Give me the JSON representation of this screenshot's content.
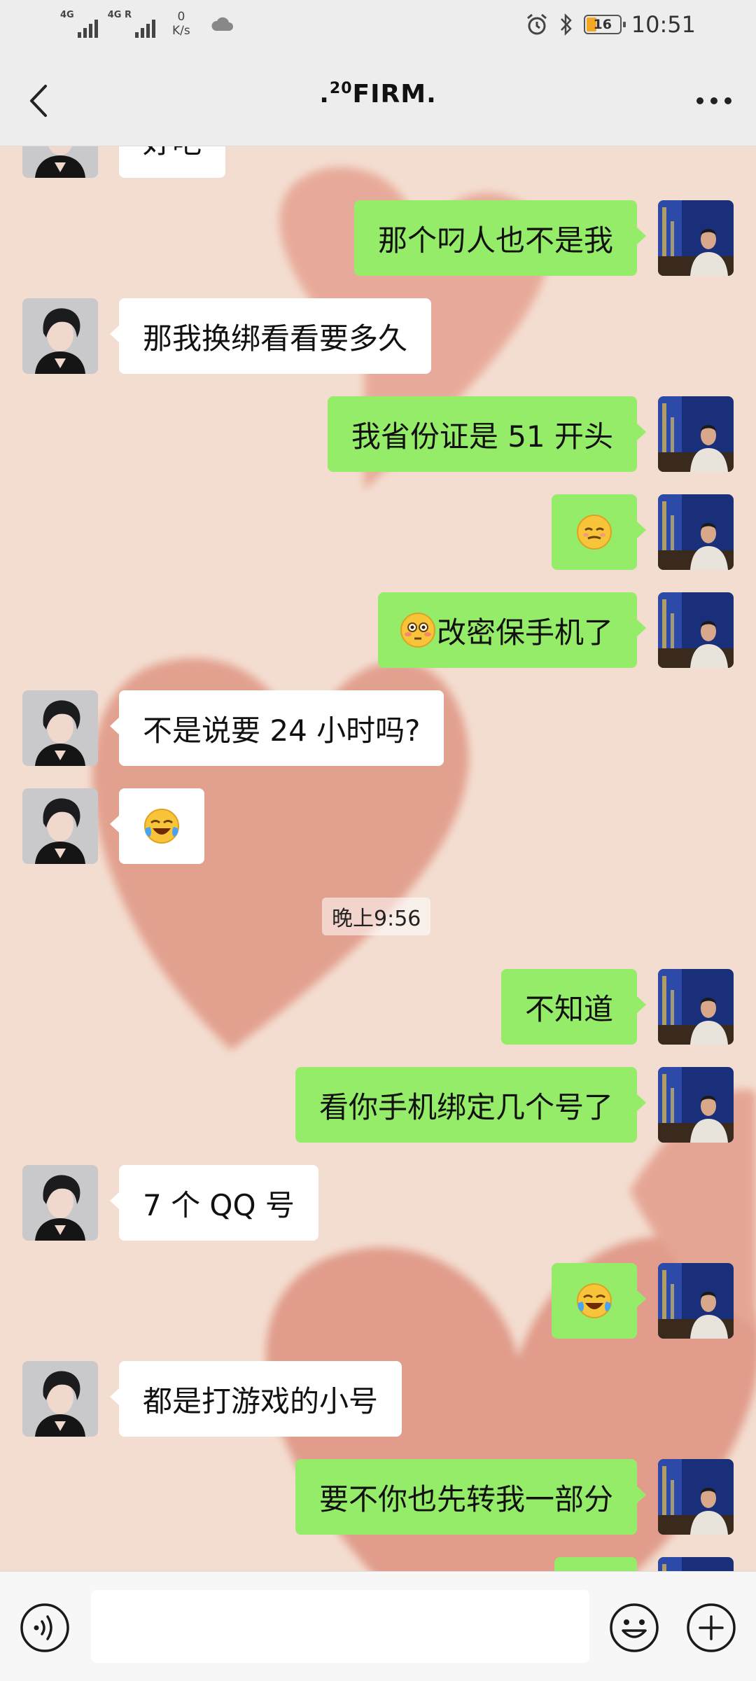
{
  "status_bar": {
    "signal1_label": "4G",
    "signal2_label": "4G R",
    "net_speed_value": "0",
    "net_speed_unit": "K/s",
    "battery_level": "16",
    "time": "10:51"
  },
  "header": {
    "title_prefix": ".",
    "title_sup": "20",
    "title_main": "FIRM."
  },
  "messages": [
    {
      "side": "left",
      "text": "好吧"
    },
    {
      "side": "right",
      "text": "那个叼人也不是我"
    },
    {
      "side": "left",
      "text": "那我换绑看看要多久"
    },
    {
      "side": "right",
      "text": "我省份证是 51 开头"
    },
    {
      "side": "right",
      "text": "",
      "emoji": "relieved-face"
    },
    {
      "side": "right",
      "text": "改密保手机了",
      "emoji": "flushed-face"
    },
    {
      "side": "left",
      "text": "不是说要 24 小时吗?"
    },
    {
      "side": "left",
      "text": "",
      "emoji": "crying-laughing-face"
    },
    {
      "side": "right",
      "text": "不知道"
    },
    {
      "side": "right",
      "text": "看你手机绑定几个号了"
    },
    {
      "side": "left",
      "text": "7 个 QQ 号"
    },
    {
      "side": "right",
      "text": "",
      "emoji": "crying-laughing-face"
    },
    {
      "side": "left",
      "text": "都是打游戏的小号"
    },
    {
      "side": "right",
      "text": "要不你也先转我一部分"
    }
  ],
  "timestamp": "晚上9:56",
  "colors": {
    "sent_bubble": "#95ec69",
    "received_bubble": "#ffffff",
    "bar_background": "#ededed"
  }
}
